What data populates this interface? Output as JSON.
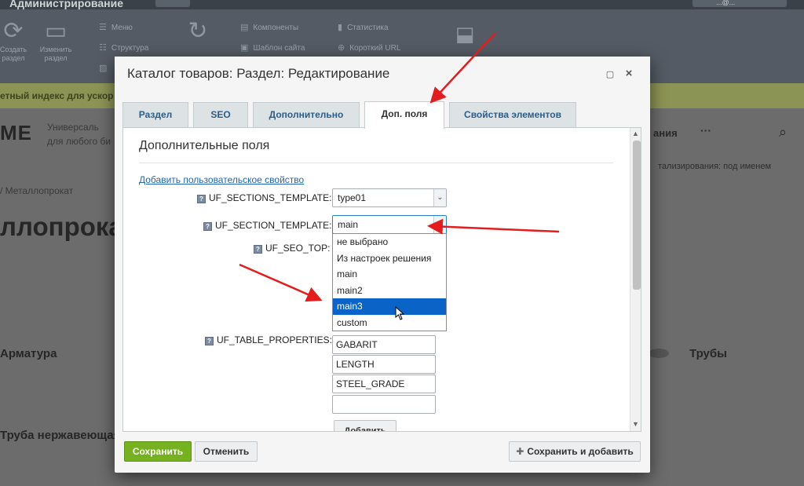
{
  "admin_bar": {
    "title": "Администрирование",
    "user": "...@...",
    "toolbar_left": [
      "Создать раздел",
      "Изменить раздел"
    ],
    "toolbar_items": [
      "Меню",
      "Структура",
      "Компоненты",
      "Шаблон сайта",
      "Статистика",
      "Короткий URL"
    ],
    "notice": "етный индекс для ускор"
  },
  "site": {
    "logo": "ME",
    "tagline": [
      "Универсаль",
      "для любого би"
    ],
    "nav_right": "ания",
    "nav_dots": "···",
    "breadcrumb": "/ Металлопрокат",
    "right_note": "тализирования: под именем",
    "page_title": "ллопрокат",
    "categories": [
      "Арматура",
      "Трубы",
      "Труба нержавеющая"
    ]
  },
  "dialog": {
    "title": "Каталог товаров: Раздел: Редактирование",
    "tabs": [
      {
        "label": "Раздел",
        "active": false
      },
      {
        "label": "SEO",
        "active": false
      },
      {
        "label": "Дополнительно",
        "active": false
      },
      {
        "label": "Доп. поля",
        "active": true
      },
      {
        "label": "Свойства элементов",
        "active": false
      }
    ],
    "section_title": "Дополнительные поля",
    "add_property_link": "Добавить пользовательское свойство",
    "fields": {
      "sections_template": {
        "label": "UF_SECTIONS_TEMPLATE:",
        "value": "type01"
      },
      "section_template": {
        "label": "UF_SECTION_TEMPLATE:",
        "value": "main"
      },
      "seo_top": {
        "label": "UF_SEO_TOP:"
      },
      "table_properties": {
        "label": "UF_TABLE_PROPERTIES:",
        "values": [
          "GABARIT",
          "LENGTH",
          "STEEL_GRADE",
          ""
        ]
      }
    },
    "dropdown_options": [
      "не выбрано",
      "Из настроек решения",
      "main",
      "main2",
      "main3",
      "custom"
    ],
    "dropdown_highlighted": "main3",
    "add_button": "Добавить",
    "buttons": {
      "save": "Сохранить",
      "cancel": "Отменить",
      "save_and_add": "Сохранить и добавить"
    }
  },
  "colors": {
    "save_green": "#76b120",
    "link_blue": "#2067b0",
    "tab_text": "#2c5d87",
    "highlight": "#0a64c8",
    "annotation_arrow": "#e31d1d"
  },
  "icons": {
    "help": "help-icon",
    "close": "close-icon",
    "maximize": "maximize-icon",
    "plus": "plus-icon"
  }
}
